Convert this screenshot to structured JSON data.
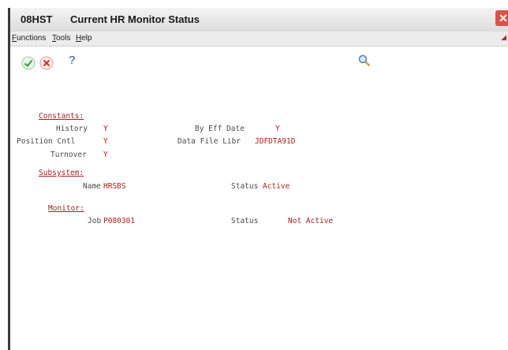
{
  "window": {
    "form_id": "08HST",
    "title": "Current HR Monitor Status",
    "close_glyph": "✕"
  },
  "menubar": {
    "functions": "Functions",
    "tools": "Tools",
    "help": "Help"
  },
  "toolbar": {
    "help_glyph": "?",
    "icons": [
      "ok-icon",
      "cancel-icon",
      "help-icon",
      "search-icon"
    ]
  },
  "constants": {
    "header": "Constants:",
    "history_label": "History",
    "history_value": "Y",
    "position_cntl_label": "Position Cntl",
    "position_cntl_value": "Y",
    "turnover_label": "Turnover",
    "turnover_value": "Y",
    "by_eff_date_label": "By Eff Date",
    "by_eff_date_value": "Y",
    "data_file_libr_label": "Data File Libr",
    "data_file_libr_value": "JDFDTA91D"
  },
  "subsystem": {
    "header": "Subsystem:",
    "name_label": "Name",
    "name_value": "HRSBS",
    "status_label": "Status",
    "status_value": "Active"
  },
  "monitor": {
    "header": "Monitor:",
    "job_label": "Job",
    "job_value": "P080301",
    "status_label": "Status",
    "status_value": "Not Active"
  },
  "colors": {
    "value_red": "#a42222",
    "label_gray": "#4a4a4a",
    "ok_green": "#3a9a3a",
    "cancel_red": "#d03030"
  }
}
